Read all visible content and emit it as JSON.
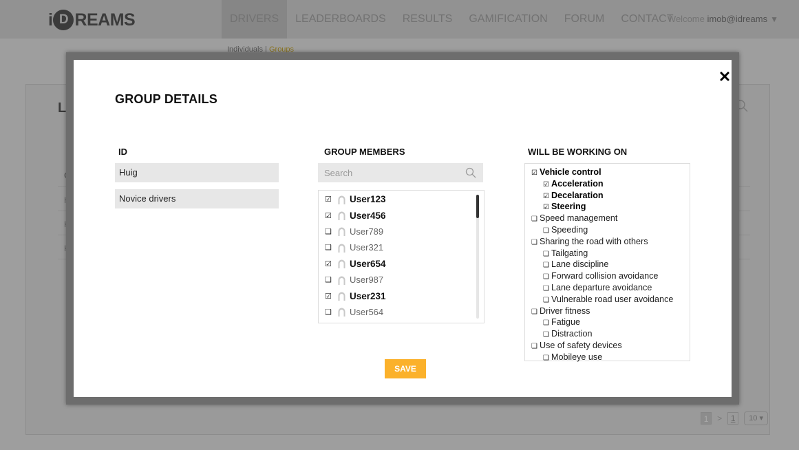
{
  "header": {
    "logo": {
      "prefix": "i",
      "mark": "D",
      "suffix": "REAMS"
    },
    "nav": [
      {
        "label": "DRIVERS",
        "active": true
      },
      {
        "label": "LEADERBOARDS",
        "active": false
      },
      {
        "label": "RESULTS",
        "active": false
      },
      {
        "label": "GAMIFICATION",
        "active": false
      },
      {
        "label": "FORUM",
        "active": false
      },
      {
        "label": "CONTACT",
        "active": false
      }
    ],
    "welcome_prefix": "Welcome ",
    "welcome_user": "imob@idreams",
    "welcome_caret": "▼"
  },
  "subnav": {
    "individuals": "Individuals",
    "separator": " | ",
    "groups": "Groups"
  },
  "background": {
    "list_title": "LIS",
    "column_head": "GI",
    "rows": [
      "Hu",
      "Ki",
      "Ki"
    ],
    "pagination": {
      "current": "1",
      "next": ">",
      "last": "1",
      "page_size": "10"
    }
  },
  "modal": {
    "title": "GROUP DETAILS",
    "close_label": "×",
    "id_column": {
      "label": "ID",
      "items": [
        "Huig",
        "Novice drivers"
      ]
    },
    "members_column": {
      "label": "GROUP MEMBERS",
      "search_placeholder": "Search",
      "members": [
        {
          "name": "User123",
          "checked": true,
          "box": "☑"
        },
        {
          "name": "User456",
          "checked": true,
          "box": "☑"
        },
        {
          "name": "User789",
          "checked": false,
          "box": "❑"
        },
        {
          "name": "User321",
          "checked": false,
          "box": "❑"
        },
        {
          "name": "User654",
          "checked": true,
          "box": "☑"
        },
        {
          "name": "User987",
          "checked": false,
          "box": "❑"
        },
        {
          "name": "User231",
          "checked": true,
          "box": "☑"
        },
        {
          "name": "User564",
          "checked": false,
          "box": "❑"
        }
      ]
    },
    "working_on_column": {
      "label": "WILL BE WORKING ON",
      "topics": [
        {
          "label": "Vehicle control",
          "checked": true,
          "level": 0,
          "box": "☑"
        },
        {
          "label": "Acceleration",
          "checked": true,
          "level": 1,
          "box": "☑"
        },
        {
          "label": "Decelaration",
          "checked": true,
          "level": 1,
          "box": "☑"
        },
        {
          "label": "Steering",
          "checked": true,
          "level": 1,
          "box": "☑"
        },
        {
          "label": "Speed management",
          "checked": false,
          "level": 0,
          "box": "❑"
        },
        {
          "label": "Speeding",
          "checked": false,
          "level": 1,
          "box": "❑"
        },
        {
          "label": "Sharing the road with others",
          "checked": false,
          "level": 0,
          "box": "❑"
        },
        {
          "label": "Tailgating",
          "checked": false,
          "level": 1,
          "box": "❑"
        },
        {
          "label": "Lane discipline",
          "checked": false,
          "level": 1,
          "box": "❑"
        },
        {
          "label": "Forward collision avoidance",
          "checked": false,
          "level": 1,
          "box": "❑"
        },
        {
          "label": "Lane departure avoidance",
          "checked": false,
          "level": 1,
          "box": "❑"
        },
        {
          "label": "Vulnerable road user avoidance",
          "checked": false,
          "level": 1,
          "box": "❑"
        },
        {
          "label": "Driver fitness",
          "checked": false,
          "level": 0,
          "box": "❑"
        },
        {
          "label": "Fatigue",
          "checked": false,
          "level": 1,
          "box": "❑"
        },
        {
          "label": "Distraction",
          "checked": false,
          "level": 1,
          "box": "❑"
        },
        {
          "label": "Use of safety devices",
          "checked": false,
          "level": 0,
          "box": "❑"
        },
        {
          "label": "Mobileye  use",
          "checked": false,
          "level": 1,
          "box": "❑"
        }
      ]
    },
    "save_label": "SAVE"
  },
  "colors": {
    "accent": "#fbb12b",
    "overlay": "#9e9e9e",
    "modal_border": "#6d6d6d",
    "field_bg": "#e7e7e7"
  }
}
